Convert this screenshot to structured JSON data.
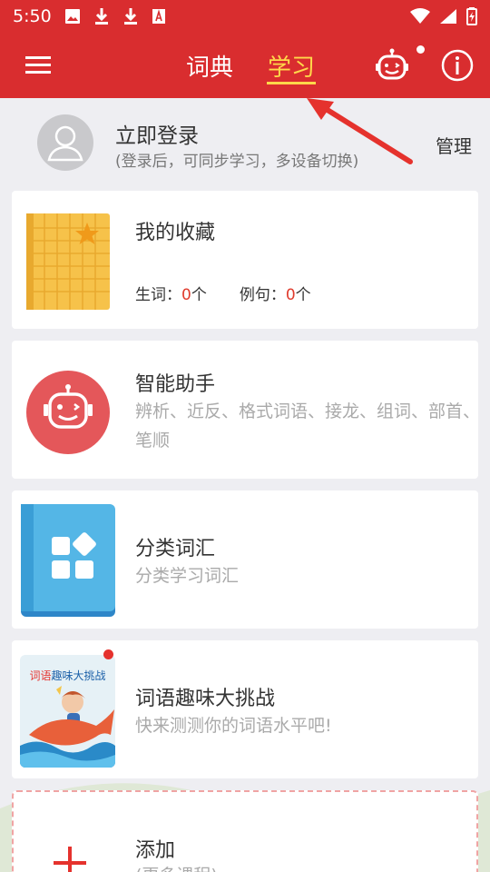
{
  "status_bar": {
    "time": "5:50"
  },
  "app_bar": {
    "tabs": [
      {
        "label": "词典",
        "active": false
      },
      {
        "label": "学习",
        "active": true
      }
    ],
    "accent_color": "#d92d2f",
    "active_tab_color": "#ffd84a"
  },
  "login": {
    "title": "立即登录",
    "subtitle": "(登录后，可同步学习，多设备切换)",
    "manage_label": "管理"
  },
  "favorites": {
    "title": "我的收藏",
    "words_label": "生词：",
    "words_count": "0",
    "sentences_label": "例句：",
    "sentences_count": "0",
    "unit": "个"
  },
  "assistant": {
    "title": "智能助手",
    "description": "辨析、近反、格式词语、接龙、组词、部首、笔顺"
  },
  "categories": {
    "title": "分类词汇",
    "description": "分类学习词汇"
  },
  "challenge": {
    "title": "词语趣味大挑战",
    "description": "快来测测你的词语水平吧!",
    "thumb_text_a": "词语",
    "thumb_text_b": "趣味大挑战"
  },
  "add": {
    "title": "添加",
    "subtitle": "(更多课程)"
  }
}
